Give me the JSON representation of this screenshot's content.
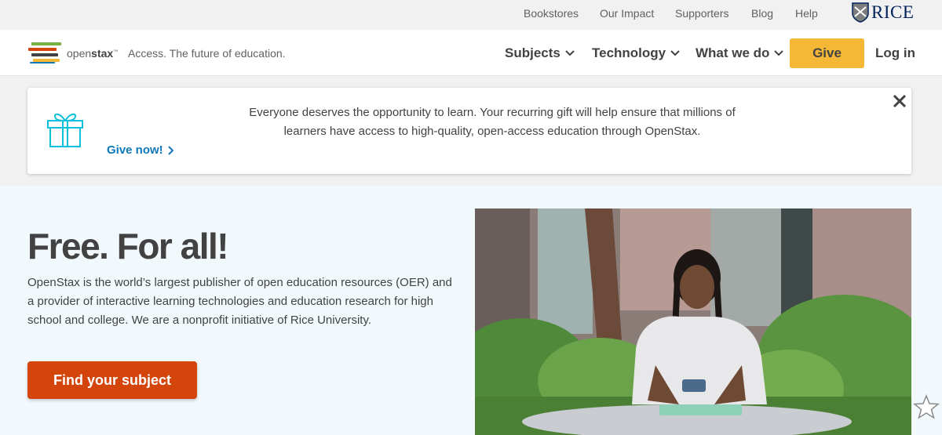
{
  "util": {
    "links": [
      "Bookstores",
      "Our Impact",
      "Supporters",
      "Blog",
      "Help"
    ],
    "rice_logo": "RICE"
  },
  "nav": {
    "brand_prefix": "open",
    "brand_bold": "stax",
    "brand_tm": "™",
    "tagline": "Access. The future of education.",
    "items": [
      "Subjects",
      "Technology",
      "What we do"
    ],
    "give": "Give",
    "login": "Log in"
  },
  "banner": {
    "text": "Everyone deserves the opportunity to learn. Your recurring gift will help ensure that millions of learners have access to high-quality, open-access education through OpenStax.",
    "give_now": "Give now!",
    "icons": [
      "gift-icon",
      "chevron-right-icon",
      "close-icon"
    ]
  },
  "hero": {
    "title": "Free. For all!",
    "body": "OpenStax is the world’s largest publisher of open education resources (OER) and a provider of interactive learning technologies and education research for high school and college. We are a nonprofit initiative of Rice University.",
    "cta": "Find your subject"
  },
  "colors": {
    "give_yellow": "#f4b736",
    "cta_orange": "#d4450c",
    "link_blue": "#0e78b8",
    "gift_teal": "#0dc0dc",
    "hero_bg": "#f1f9fc"
  }
}
